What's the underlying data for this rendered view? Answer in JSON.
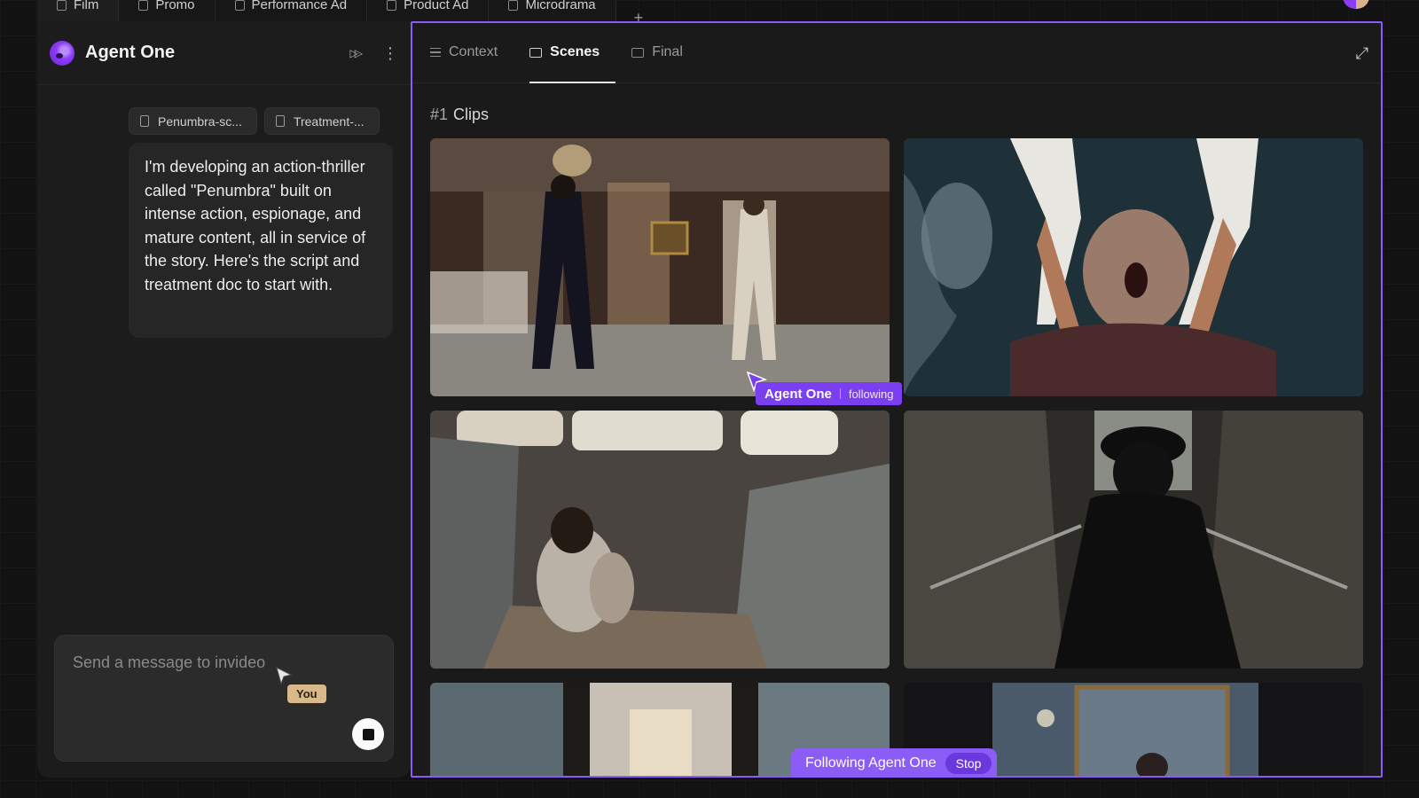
{
  "top_tabs": [
    {
      "label": "Film",
      "active": true
    },
    {
      "label": "Promo",
      "active": false
    },
    {
      "label": "Performance Ad",
      "active": false
    },
    {
      "label": "Product Ad",
      "active": false
    },
    {
      "label": "Microdrama",
      "active": false
    }
  ],
  "top_plus": "+",
  "agent": {
    "name": "Agent One",
    "attachments": [
      {
        "label": "Penumbra-sc..."
      },
      {
        "label": "Treatment-..."
      }
    ],
    "message": "I'm developing an action-thriller called \"Penumbra\" built on intense action, espionage, and mature content, all in service of the story. Here's the script and treatment doc to start with.",
    "composer_placeholder": "Send a message to invideo",
    "you_tag": "You"
  },
  "workspace": {
    "tabs": [
      {
        "label": "Context",
        "icon": "list-icon",
        "active": false
      },
      {
        "label": "Scenes",
        "icon": "folder-icon",
        "active": true
      },
      {
        "label": "Final",
        "icon": "folder-icon",
        "active": false
      }
    ],
    "section_number": "#1",
    "section_title": "Clips",
    "clips": [
      {
        "desc": "hotel-room-confrontation"
      },
      {
        "desc": "underwater-drowning"
      },
      {
        "desc": "girl-in-abandoned-car"
      },
      {
        "desc": "silhouette-in-stairwell"
      },
      {
        "desc": "hallway-corridor"
      },
      {
        "desc": "mirror-chandelier-room"
      }
    ],
    "agent_badge": {
      "name": "Agent One",
      "status": "following"
    },
    "follow_banner": {
      "text": "Following Agent One",
      "stop": "Stop"
    }
  },
  "colors": {
    "accent": "#8b5cf6",
    "you_tag": "#d9b98a"
  }
}
